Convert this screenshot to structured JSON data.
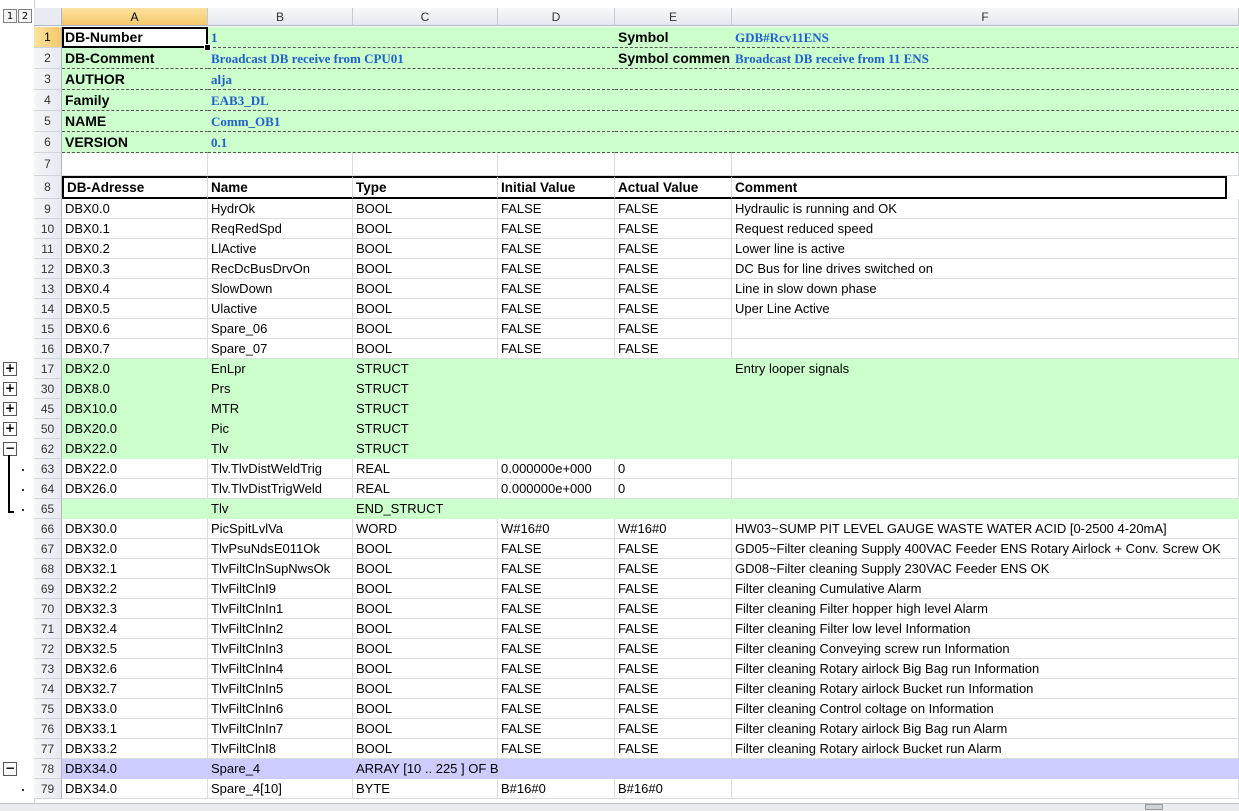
{
  "outline_levels": [
    "1",
    "2"
  ],
  "columns": [
    "A",
    "B",
    "C",
    "D",
    "E",
    "F"
  ],
  "selected_cell": "A1",
  "meta_rows": [
    {
      "row": "1",
      "label_a": "DB-Number",
      "value_b": "1",
      "label_e": "Symbol",
      "value_f": "GDB#Rcv11ENS"
    },
    {
      "row": "2",
      "label_a": "DB-Comment",
      "value_b": "Broadcast DB receive from CPU01",
      "label_e": "Symbol commen",
      "value_f": "Broadcast DB receive from 11 ENS"
    },
    {
      "row": "3",
      "label_a": "AUTHOR",
      "value_b": "alja",
      "label_e": "",
      "value_f": ""
    },
    {
      "row": "4",
      "label_a": "Family",
      "value_b": "EAB3_DL",
      "label_e": "",
      "value_f": ""
    },
    {
      "row": "5",
      "label_a": "NAME",
      "value_b": "Comm_OB1",
      "label_e": "",
      "value_f": ""
    },
    {
      "row": "6",
      "label_a": "VERSION",
      "value_b": "0.1",
      "label_e": "",
      "value_f": ""
    }
  ],
  "blank_row": "7",
  "header_row": {
    "row": "8",
    "cells": [
      "DB-Adresse",
      "Name",
      "Type",
      "Initial Value",
      "Actual Value",
      "Comment"
    ]
  },
  "data_rows": [
    {
      "row": "9",
      "style": "",
      "cells": [
        "DBX0.0",
        "HydrOk",
        "BOOL",
        "FALSE",
        "FALSE",
        "Hydraulic is running and OK"
      ]
    },
    {
      "row": "10",
      "style": "",
      "cells": [
        "DBX0.1",
        "ReqRedSpd",
        "BOOL",
        "FALSE",
        "FALSE",
        "Request reduced speed"
      ]
    },
    {
      "row": "11",
      "style": "",
      "cells": [
        "DBX0.2",
        "LlActive",
        "BOOL",
        "FALSE",
        "FALSE",
        "Lower line is active"
      ]
    },
    {
      "row": "12",
      "style": "",
      "cells": [
        "DBX0.3",
        "RecDcBusDrvOn",
        "BOOL",
        "FALSE",
        "FALSE",
        "DC Bus for line drives switched on"
      ]
    },
    {
      "row": "13",
      "style": "",
      "cells": [
        "DBX0.4",
        "SlowDown",
        "BOOL",
        "FALSE",
        "FALSE",
        "Line in slow down phase"
      ]
    },
    {
      "row": "14",
      "style": "",
      "cells": [
        "DBX0.5",
        "Ulactive",
        "BOOL",
        "FALSE",
        "FALSE",
        "Uper Line Active"
      ]
    },
    {
      "row": "15",
      "style": "",
      "cells": [
        "DBX0.6",
        "Spare_06",
        "BOOL",
        "FALSE",
        "FALSE",
        ""
      ]
    },
    {
      "row": "16",
      "style": "",
      "cells": [
        "DBX0.7",
        "Spare_07",
        "BOOL",
        "FALSE",
        "FALSE",
        ""
      ]
    },
    {
      "row": "17",
      "style": "green",
      "cells": [
        "DBX2.0",
        "EnLpr",
        "STRUCT",
        "",
        "",
        "Entry looper signals"
      ]
    },
    {
      "row": "30",
      "style": "green",
      "cells": [
        "DBX8.0",
        "Prs",
        "STRUCT",
        "",
        "",
        ""
      ]
    },
    {
      "row": "45",
      "style": "green",
      "cells": [
        "DBX10.0",
        "MTR",
        "STRUCT",
        "",
        "",
        ""
      ]
    },
    {
      "row": "50",
      "style": "green",
      "cells": [
        "DBX20.0",
        "Pic",
        "STRUCT",
        "",
        "",
        ""
      ]
    },
    {
      "row": "62",
      "style": "green",
      "cells": [
        "DBX22.0",
        "Tlv",
        "STRUCT",
        "",
        "",
        ""
      ]
    },
    {
      "row": "63",
      "style": "",
      "cells": [
        "DBX22.0",
        "Tlv.TlvDistWeldTrig",
        "REAL",
        "0.000000e+000",
        "0",
        ""
      ]
    },
    {
      "row": "64",
      "style": "",
      "cells": [
        "DBX26.0",
        "Tlv.TlvDistTrigWeld",
        "REAL",
        "0.000000e+000",
        "0",
        ""
      ]
    },
    {
      "row": "65",
      "style": "green",
      "cells": [
        "",
        "Tlv",
        "END_STRUCT",
        "",
        "",
        ""
      ]
    },
    {
      "row": "66",
      "style": "",
      "cells": [
        "DBX30.0",
        "PicSpitLvlVa",
        "WORD",
        "W#16#0",
        "W#16#0",
        "HW03~SUMP PIT LEVEL GAUGE WASTE WATER ACID [0-2500 4-20mA]"
      ]
    },
    {
      "row": "67",
      "style": "",
      "cells": [
        "DBX32.0",
        "TlvPsuNdsE011Ok",
        "BOOL",
        "FALSE",
        "FALSE",
        "GD05~Filter cleaning Supply 400VAC Feeder ENS Rotary Airlock + Conv. Screw OK"
      ]
    },
    {
      "row": "68",
      "style": "",
      "cells": [
        "DBX32.1",
        "TlvFiltClnSupNwsOk",
        "BOOL",
        "FALSE",
        "FALSE",
        "GD08~Filter cleaning Supply 230VAC Feeder ENS OK"
      ]
    },
    {
      "row": "69",
      "style": "",
      "cells": [
        "DBX32.2",
        "TlvFiltClnI9",
        "BOOL",
        "FALSE",
        "FALSE",
        "Filter cleaning Cumulative Alarm"
      ]
    },
    {
      "row": "70",
      "style": "",
      "cells": [
        "DBX32.3",
        "TlvFiltClnIn1",
        "BOOL",
        "FALSE",
        "FALSE",
        "Filter cleaning Filter hopper high level  Alarm"
      ]
    },
    {
      "row": "71",
      "style": "",
      "cells": [
        "DBX32.4",
        "TlvFiltClnIn2",
        "BOOL",
        "FALSE",
        "FALSE",
        "Filter cleaning Filter low level Information"
      ]
    },
    {
      "row": "72",
      "style": "",
      "cells": [
        "DBX32.5",
        "TlvFiltClnIn3",
        "BOOL",
        "FALSE",
        "FALSE",
        "Filter cleaning Conveying screw run Information"
      ]
    },
    {
      "row": "73",
      "style": "",
      "cells": [
        "DBX32.6",
        "TlvFiltClnIn4",
        "BOOL",
        "FALSE",
        "FALSE",
        "Filter cleaning Rotary airlock Big Bag run Information"
      ]
    },
    {
      "row": "74",
      "style": "",
      "cells": [
        "DBX32.7",
        "TlvFiltClnIn5",
        "BOOL",
        "FALSE",
        "FALSE",
        "Filter cleaning Rotary airlock Bucket run Information"
      ]
    },
    {
      "row": "75",
      "style": "",
      "cells": [
        "DBX33.0",
        "TlvFiltClnIn6",
        "BOOL",
        "FALSE",
        "FALSE",
        "Filter cleaning Control coltage on Information"
      ]
    },
    {
      "row": "76",
      "style": "",
      "cells": [
        "DBX33.1",
        "TlvFiltClnIn7",
        "BOOL",
        "FALSE",
        "FALSE",
        "Filter cleaning Rotary airlock Big Bag run Alarm"
      ]
    },
    {
      "row": "77",
      "style": "",
      "cells": [
        "DBX33.2",
        "TlvFiltClnI8",
        "BOOL",
        "FALSE",
        "FALSE",
        "Filter cleaning Rotary airlock Bucket run Alarm"
      ]
    },
    {
      "row": "78",
      "style": "lav",
      "cells": [
        "DBX34.0",
        "Spare_4",
        "ARRAY  [10 .. 225 ] OF B'",
        "",
        "",
        ""
      ]
    },
    {
      "row": "79",
      "style": "",
      "cells": [
        "DBX34.0",
        "Spare_4[10]",
        "BYTE",
        "B#16#0",
        "B#16#0",
        ""
      ]
    }
  ],
  "outline_buttons": [
    {
      "row": "17",
      "symbol": "+"
    },
    {
      "row": "30",
      "symbol": "+"
    },
    {
      "row": "45",
      "symbol": "+"
    },
    {
      "row": "50",
      "symbol": "+"
    },
    {
      "row": "62",
      "symbol": "−"
    },
    {
      "row": "78",
      "symbol": "−"
    }
  ]
}
